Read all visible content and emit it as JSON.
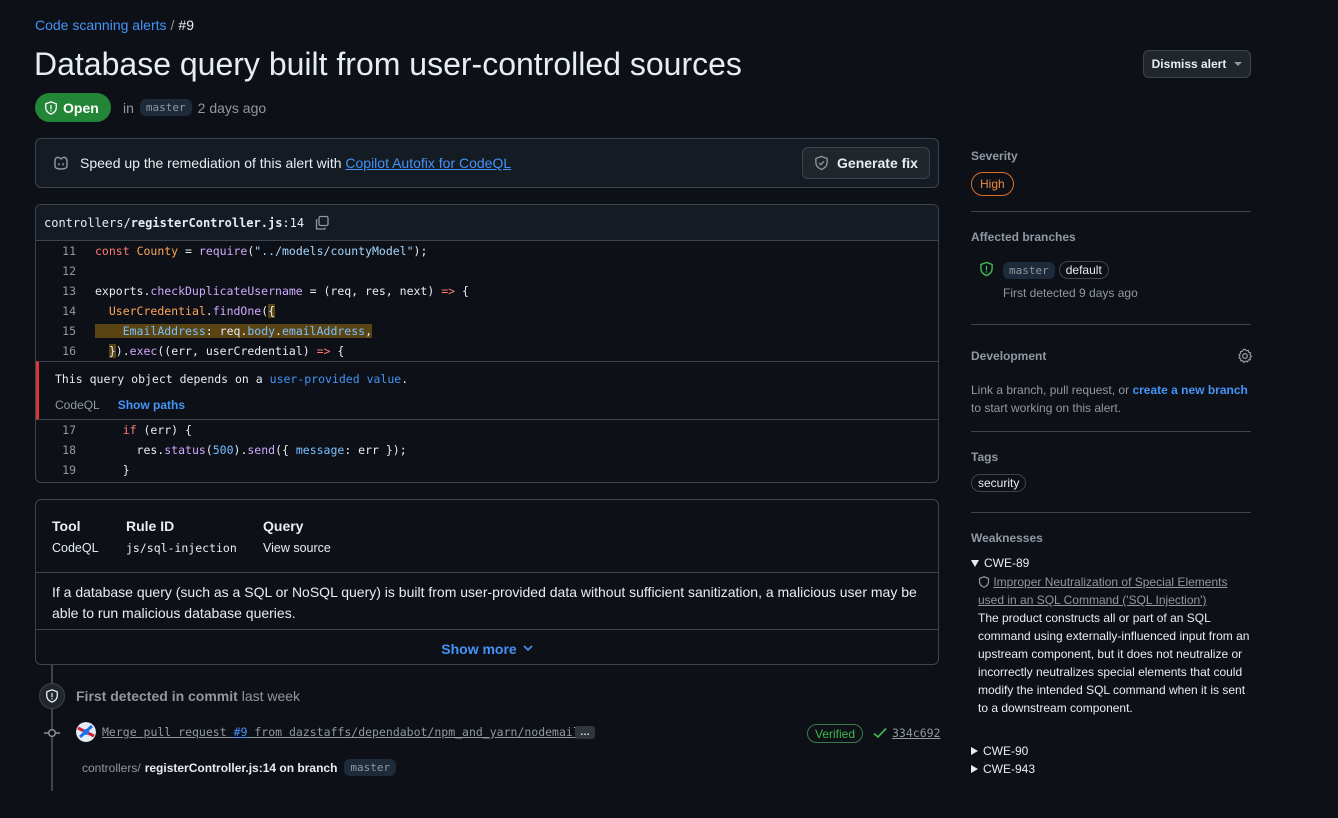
{
  "breadcrumb": {
    "parent": "Code scanning alerts",
    "separator": "/",
    "current": "#9"
  },
  "alert": {
    "title": "Database query built from user-controlled sources",
    "state": "Open",
    "in_text": "in",
    "branch": "master",
    "age": "2 days ago",
    "dismiss_label": "Dismiss alert"
  },
  "copilot": {
    "text": "Speed up the remediation of this alert with ",
    "link": "Copilot Autofix for CodeQL",
    "button": "Generate fix"
  },
  "code": {
    "file_dir": "controllers/",
    "file_name": "registerController.js",
    "file_line": ":14",
    "lines_before": [
      {
        "n": "11"
      },
      {
        "n": "12"
      },
      {
        "n": "13"
      },
      {
        "n": "14"
      },
      {
        "n": "15"
      },
      {
        "n": "16"
      }
    ],
    "lines_after": [
      {
        "n": "17"
      },
      {
        "n": "18"
      },
      {
        "n": "19"
      }
    ],
    "alert_message_pre": "This query object depends on a ",
    "alert_message_link": "user-provided value",
    "alert_message_post": ".",
    "tool": "CodeQL",
    "show_paths": "Show paths"
  },
  "info": {
    "tool_label": "Tool",
    "tool_value": "CodeQL",
    "rule_label": "Rule ID",
    "rule_value": "js/sql-injection",
    "query_label": "Query",
    "query_value": "View source",
    "description": "If a database query (such as a SQL or NoSQL query) is built from user-provided data without sufficient sanitization, a malicious user may be able to run malicious database queries.",
    "show_more": "Show more"
  },
  "timeline": {
    "first_detected_bold": "First detected in commit",
    "first_detected_age": "last week",
    "commit_msg_pre": "Merge pull request ",
    "commit_pr": "#9",
    "commit_msg_post": " from dazstaffs/dependabot/npm_and_yarn/nodemail…",
    "ellipsis": "…",
    "verified": "Verified",
    "sha": "334c692",
    "loc_dir": "controllers/",
    "loc_file": "registerController.js:14 on branch",
    "loc_branch": "master"
  },
  "sidebar": {
    "severity_label": "Severity",
    "severity_value": "High",
    "affected_label": "Affected branches",
    "affected_branch": "master",
    "affected_default": "default",
    "affected_first": "First detected 9 days ago",
    "dev_label": "Development",
    "dev_text_pre": "Link a branch, pull request, or ",
    "dev_text_link": "create a new branch",
    "dev_text_post": " to start working on this alert.",
    "tags_label": "Tags",
    "tag": "security",
    "weak_label": "Weaknesses",
    "cwe_open": "CWE-89",
    "cwe_open_title": "Improper Neutralization of Special Elements used in an SQL Command ('SQL Injection')",
    "cwe_open_desc": "The product constructs all or part of an SQL command using externally-influenced input from an upstream component, but it does not neutralize or incorrectly neutralizes special elements that could modify the intended SQL command when it is sent to a downstream component.",
    "cwe_2": "CWE-90",
    "cwe_3": "CWE-943"
  },
  "colors": {
    "accent": "#4493f8",
    "open": "#238636",
    "high": "#db6d28",
    "alert": "#da3633",
    "bg": "#0d1117"
  }
}
